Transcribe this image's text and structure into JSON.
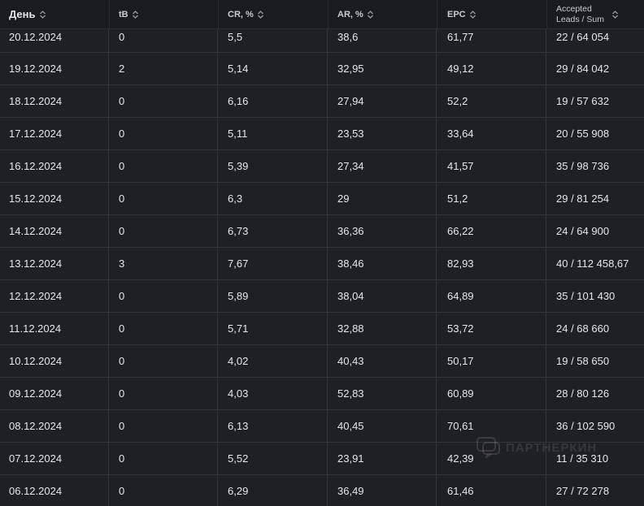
{
  "columns": [
    {
      "key": "day",
      "label": "День"
    },
    {
      "key": "tb",
      "label": "tB"
    },
    {
      "key": "cr",
      "label": "CR, %"
    },
    {
      "key": "ar",
      "label": "AR, %"
    },
    {
      "key": "epc",
      "label": "EPC"
    },
    {
      "key": "leads",
      "label": "Accepted Leads / Sum"
    }
  ],
  "rows": [
    {
      "day": "20.12.2024",
      "tb": "0",
      "cr": "5,5",
      "ar": "38,6",
      "epc": "61,77",
      "leads": "22  /  64 054"
    },
    {
      "day": "19.12.2024",
      "tb": "2",
      "cr": "5,14",
      "ar": "32,95",
      "epc": "49,12",
      "leads": "29  /  84 042"
    },
    {
      "day": "18.12.2024",
      "tb": "0",
      "cr": "6,16",
      "ar": "27,94",
      "epc": "52,2",
      "leads": "19  /  57 632"
    },
    {
      "day": "17.12.2024",
      "tb": "0",
      "cr": "5,11",
      "ar": "23,53",
      "epc": "33,64",
      "leads": "20  /  55 908"
    },
    {
      "day": "16.12.2024",
      "tb": "0",
      "cr": "5,39",
      "ar": "27,34",
      "epc": "41,57",
      "leads": "35  /  98 736"
    },
    {
      "day": "15.12.2024",
      "tb": "0",
      "cr": "6,3",
      "ar": "29",
      "epc": "51,2",
      "leads": "29  /  81 254"
    },
    {
      "day": "14.12.2024",
      "tb": "0",
      "cr": "6,73",
      "ar": "36,36",
      "epc": "66,22",
      "leads": "24  /  64 900"
    },
    {
      "day": "13.12.2024",
      "tb": "3",
      "cr": "7,67",
      "ar": "38,46",
      "epc": "82,93",
      "leads": "40  /  112 458,67"
    },
    {
      "day": "12.12.2024",
      "tb": "0",
      "cr": "5,89",
      "ar": "38,04",
      "epc": "64,89",
      "leads": "35  /  101 430"
    },
    {
      "day": "11.12.2024",
      "tb": "0",
      "cr": "5,71",
      "ar": "32,88",
      "epc": "53,72",
      "leads": "24  /  68 660"
    },
    {
      "day": "10.12.2024",
      "tb": "0",
      "cr": "4,02",
      "ar": "40,43",
      "epc": "50,17",
      "leads": "19  /  58 650"
    },
    {
      "day": "09.12.2024",
      "tb": "0",
      "cr": "4,03",
      "ar": "52,83",
      "epc": "60,89",
      "leads": "28  /  80 126"
    },
    {
      "day": "08.12.2024",
      "tb": "0",
      "cr": "6,13",
      "ar": "40,45",
      "epc": "70,61",
      "leads": "36  /  102 590"
    },
    {
      "day": "07.12.2024",
      "tb": "0",
      "cr": "5,52",
      "ar": "23,91",
      "epc": "42,39",
      "leads": "11  /  35 310"
    },
    {
      "day": "06.12.2024",
      "tb": "0",
      "cr": "6,29",
      "ar": "36,49",
      "epc": "61,46",
      "leads": "27  /  72 278"
    }
  ],
  "watermark": {
    "text": "ПАРТНЕРКИН",
    "icon": "chat-bubble-icon"
  },
  "colors": {
    "background": "#1f2024",
    "header": "#1a1b1e",
    "grid": "#34353a",
    "text": "#e6e7ea"
  }
}
